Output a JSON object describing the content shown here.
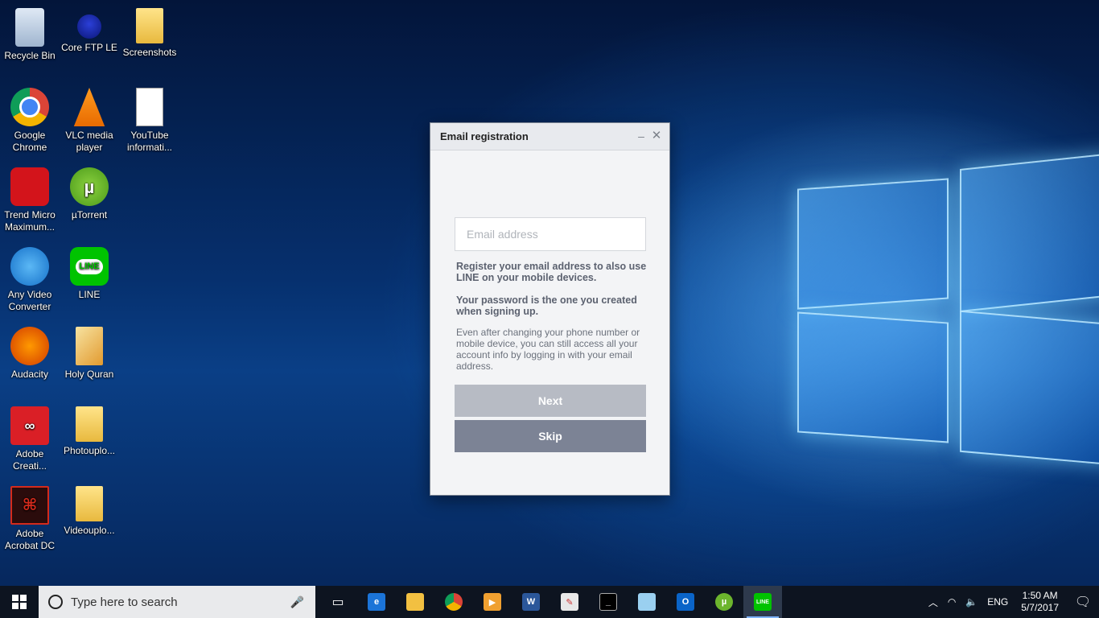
{
  "desktop": {
    "icons": [
      {
        "label": "Recycle Bin"
      },
      {
        "label": "Core FTP LE"
      },
      {
        "label": "Screenshots"
      },
      {
        "label": "Google Chrome"
      },
      {
        "label": "VLC media player"
      },
      {
        "label": "YouTube informati..."
      },
      {
        "label": "Trend Micro Maximum..."
      },
      {
        "label": "µTorrent"
      },
      {
        "label": "Any Video Converter"
      },
      {
        "label": "LINE"
      },
      {
        "label": "Audacity"
      },
      {
        "label": "Holy Quran"
      },
      {
        "label": "Adobe Creati..."
      },
      {
        "label": "Photouplo..."
      },
      {
        "label": "Adobe Acrobat DC"
      },
      {
        "label": "Videouplo..."
      }
    ]
  },
  "dialog": {
    "title": "Email registration",
    "minimize_glyph": "–",
    "close_glyph": "✕",
    "email_placeholder": "Email address",
    "text_register": "Register your email address to also use LINE on your mobile devices.",
    "text_password": "Your password is the one you created when signing up.",
    "text_info": "Even after changing your phone number or mobile device, you can still access all your account info by logging in with your email address.",
    "next_label": "Next",
    "skip_label": "Skip",
    "colors": {
      "next": "#b7bbc4",
      "skip": "#7c8395"
    }
  },
  "taskbar": {
    "search_placeholder": "Type here to search",
    "language": "ENG",
    "time": "1:50 AM",
    "date": "5/7/2017"
  }
}
